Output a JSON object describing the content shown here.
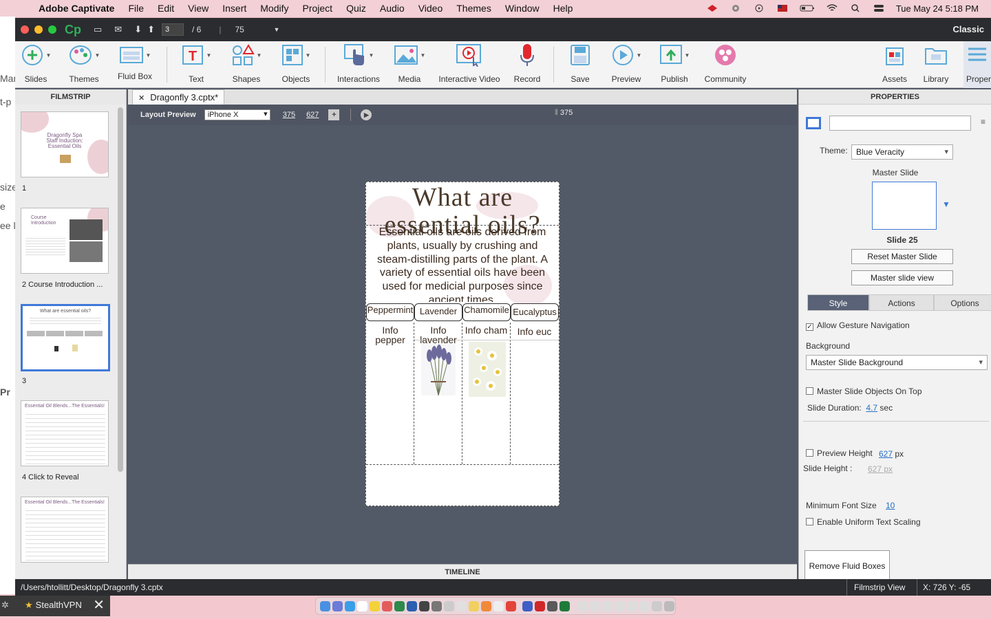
{
  "menubar": {
    "app": "Adobe Captivate",
    "items": [
      "File",
      "Edit",
      "View",
      "Insert",
      "Modify",
      "Project",
      "Quiz",
      "Audio",
      "Video",
      "Themes",
      "Window",
      "Help"
    ],
    "clock": "Tue May 24  5:18 PM"
  },
  "titlebar": {
    "logo": "Cp",
    "slide_current": "3",
    "slide_total": "/  6",
    "zoom": "75",
    "mode": "Classic"
  },
  "toolbar": {
    "slides": "Slides",
    "themes": "Themes",
    "fluid_box": "Fluid Box",
    "text": "Text",
    "shapes": "Shapes",
    "objects": "Objects",
    "interactions": "Interactions",
    "media": "Media",
    "interactive_video": "Interactive Video",
    "record": "Record",
    "save": "Save",
    "preview": "Preview",
    "publish": "Publish",
    "community": "Community",
    "assets": "Assets",
    "library": "Library",
    "properties": "Properti"
  },
  "filmstrip": {
    "title": "FILMSTRIP",
    "slides": [
      {
        "label": "1",
        "thumb_title": "Dragonfly Spa\nStaff Induction:\nEssential Oils"
      },
      {
        "label": "2 Course Introduction ...",
        "thumb_title": "Course\nIntroduction"
      },
      {
        "label": "3",
        "thumb_title": "What are essential oils?"
      },
      {
        "label": "4 Click to Reveal",
        "thumb_title": "Essential Oil Blends...The Essentials!"
      },
      {
        "label": "",
        "thumb_title": "Essential Oil Blends...The Essentials!"
      }
    ]
  },
  "document": {
    "tab_title": "Dragonfly 3.cptx*",
    "layout_preview_label": "Layout Preview",
    "device": "iPhone X",
    "width": "375",
    "height": "627",
    "ruler_value": "375"
  },
  "slide": {
    "title": "What are essential oils?",
    "body": "Essential oils are oils derived from plants, usually by crushing and steam-distilling parts of the plant. A variety of essential oils have been used for medicial purposes since ancient times.",
    "tabs": [
      "Peppermint",
      "Lavender",
      "Chamomile",
      "Eucalyptus"
    ],
    "infos": [
      "Info pepper",
      "Info lavender",
      "Info cham",
      "Info euc"
    ]
  },
  "timeline": "TIMELINE",
  "properties": {
    "title": "PROPERTIES",
    "theme_label": "Theme:",
    "theme_value": "Blue Veracity",
    "master_slide_label": "Master Slide",
    "master_slide_name": "Slide 25",
    "reset_master": "Reset Master Slide",
    "master_view": "Master slide view",
    "tabs": [
      "Style",
      "Actions",
      "Options"
    ],
    "allow_gesture": "Allow Gesture Navigation",
    "background_label": "Background",
    "background_value": "Master Slide Background",
    "objects_on_top": "Master Slide Objects On Top",
    "duration_label": "Slide Duration:",
    "duration_value": "4.7",
    "duration_unit": "sec",
    "preview_height_label": "Preview Height",
    "preview_height_value": "627",
    "preview_height_unit": "px",
    "slide_height_label": "Slide Height :",
    "slide_height_value": "627 px",
    "min_font_label": "Minimum Font Size",
    "min_font_value": "10",
    "uniform_scaling": "Enable Uniform Text Scaling",
    "remove_fluid": "Remove Fluid Boxes"
  },
  "statusbar": {
    "path": "/Users/htollitt/Desktop/Dragonfly 3.cptx",
    "view": "Filmstrip View",
    "coords": "X: 726 Y: -65"
  },
  "taskbar": {
    "vpn": "StealthVPN"
  },
  "colors": {
    "accent": "#3e79d8",
    "window_bg": "#535a67",
    "titlebar": "#2b2c2f",
    "style_tab": "#596276"
  }
}
